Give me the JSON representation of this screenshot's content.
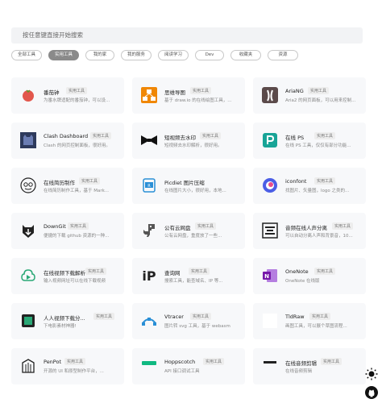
{
  "search": {
    "placeholder": "按任意键直接开始搜索"
  },
  "tabs": [
    {
      "label": "全部工具",
      "active": false
    },
    {
      "label": "实用工具",
      "active": true
    },
    {
      "label": "我的家",
      "active": false
    },
    {
      "label": "我的服务",
      "active": false
    },
    {
      "label": "阅读学习",
      "active": false
    },
    {
      "label": "Dev",
      "active": false
    },
    {
      "label": "收藏夹",
      "active": false
    },
    {
      "label": "资源",
      "active": false
    }
  ],
  "cards": [
    {
      "name": "番茄钟",
      "badge": "实用工具",
      "desc": "为番水牌适配的番茄钟，可以设...",
      "icon": "tomato-icon"
    },
    {
      "name": "思维导图",
      "badge": "实用工具",
      "desc": "基于 draw.io 的在线绘图工具，...",
      "icon": "mindmap-icon"
    },
    {
      "name": "AriaNG",
      "badge": "实用工具",
      "desc": "Aria2 的网页面板，可以用来控制...",
      "icon": "ariang-icon"
    },
    {
      "name": "Clash Dashboard",
      "badge": "实用工具",
      "desc": "Clash 的网页控制面板，很好用。",
      "icon": "clash-icon"
    },
    {
      "name": "短视频去水印",
      "badge": "实用工具",
      "desc": "短视频去水印解析，很好用。",
      "icon": "bowtie-icon"
    },
    {
      "name": "在线 PS",
      "badge": "实用工具",
      "desc": "在线 PS 工具，仅仅有部分功能...",
      "icon": "photopea-icon"
    },
    {
      "name": "在线简历制作",
      "badge": "实用工具",
      "desc": "在线简历制作工具，基于 Mark...",
      "icon": "resume-icon"
    },
    {
      "name": "Picdiet 图片压缩",
      "badge": "",
      "desc": "在线图片大小，很好用，本地...",
      "icon": "picdiet-icon"
    },
    {
      "name": "iconfont",
      "badge": "实用工具",
      "desc": "找图片、矢量图，logo 之类的...",
      "icon": "iconfont-icon"
    },
    {
      "name": "DownGit",
      "badge": "实用工具",
      "desc": "便捷的下载 github 资源的一种...",
      "icon": "downgit-icon"
    },
    {
      "name": "公有云网盘",
      "badge": "实用工具",
      "desc": "公有云网盘，重度放了一些...",
      "icon": "dino-icon"
    },
    {
      "name": "音频在线人声分离",
      "badge": "实用工具",
      "desc": "可以自动分离人声和背景音，10...",
      "icon": "audio-icon"
    },
    {
      "name": "在线视频下载解析",
      "badge": "实用工具",
      "desc": "输入视频网址可以在线下载视频",
      "icon": "video-download-icon"
    },
    {
      "name": "查询网",
      "badge": "实用工具",
      "desc": "搜索工具，能查域名、IP 等...",
      "icon": "ip-icon"
    },
    {
      "name": "OneNote",
      "badge": "实用工具",
      "desc": "OneNote 在线版",
      "icon": "onenote-icon"
    },
    {
      "name": "人人视频下载分...",
      "badge": "实用工具",
      "desc": "下电影素材神器!",
      "icon": "film-icon"
    },
    {
      "name": "Vtracer",
      "badge": "实用工具",
      "desc": "图片转 svg 工具，基于 webasm",
      "icon": "vtracer-icon"
    },
    {
      "name": "TldRaw",
      "badge": "实用工具",
      "desc": "画图工具，可以展个草图流程...",
      "icon": "tldraw-icon"
    },
    {
      "name": "PenPot",
      "badge": "实用工具",
      "desc": "开源的 UI 和原型制作平台，...",
      "icon": "penpot-icon"
    },
    {
      "name": "Hoppscotch",
      "badge": "实用工具",
      "desc": "API 接口调试工具",
      "icon": "hoppscotch-icon"
    },
    {
      "name": "在线音频剪辑",
      "badge": "实用工具",
      "desc": "在线音频剪辑",
      "icon": "audio-cut-icon"
    }
  ],
  "side": {
    "theme_icon": "sun-icon",
    "github_icon": "github-icon"
  }
}
